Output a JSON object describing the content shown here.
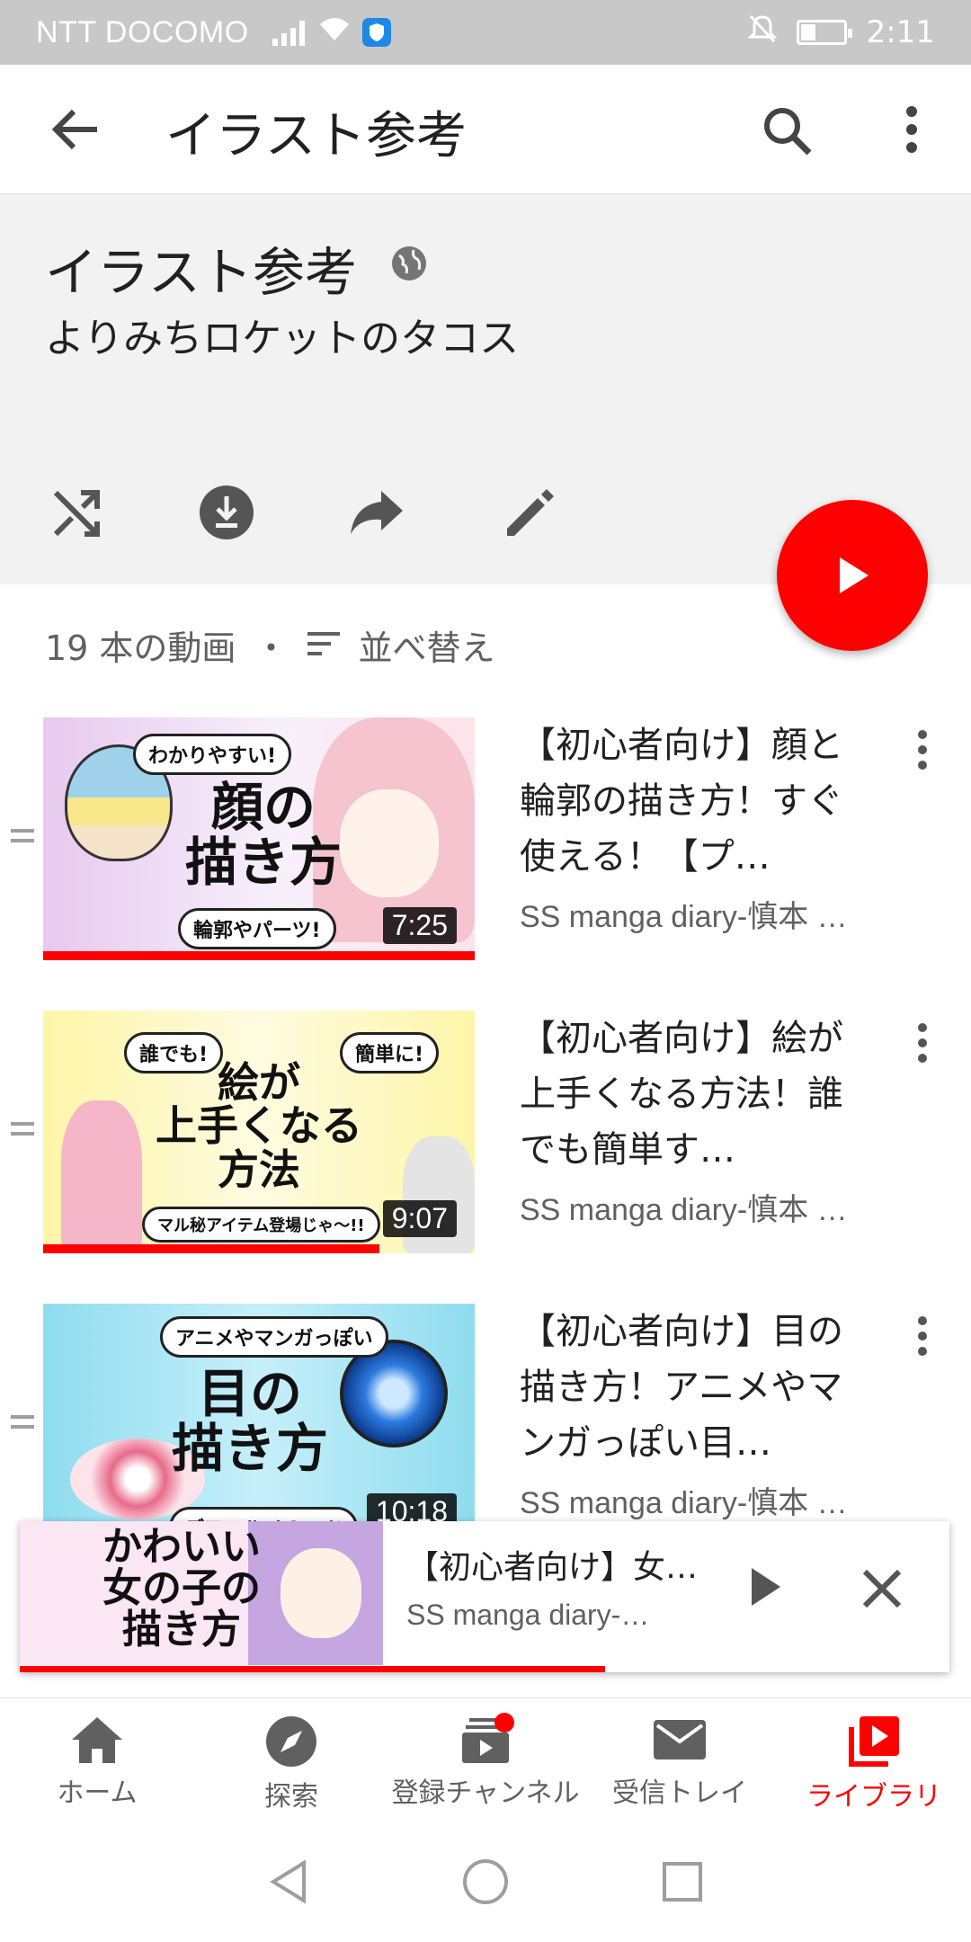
{
  "status_bar": {
    "carrier": "NTT DOCOMO",
    "time": "2:11",
    "icons": [
      "signal-icon",
      "wifi-icon",
      "vpn-shield-icon",
      "mute-icon",
      "battery-icon"
    ],
    "battery_level": 0.35
  },
  "app_bar": {
    "title": "イラスト参考",
    "icons": [
      "back-arrow-icon",
      "search-icon",
      "more-vert-icon"
    ]
  },
  "playlist": {
    "title": "イラスト参考",
    "owner": "よりみちロケットのタコス",
    "privacy_icon": "globe-icon",
    "actions": [
      "shuffle-icon",
      "download-icon",
      "share-icon",
      "edit-icon"
    ],
    "count": "19 本の動画",
    "separator": "・",
    "sort_label": "並べ替え"
  },
  "videos": [
    {
      "title": "【初心者向け】顔と輪郭の描き方！すぐ使える！【プ…",
      "channel": "SS manga diary-慎本 …",
      "duration": "7:25",
      "progress": 1.0,
      "thumb_main": "顔の\n描き方",
      "thumb_bubble": "わかりやすい!",
      "thumb_sub": "輪郭やパーツ!"
    },
    {
      "title": "【初心者向け】絵が上手くなる方法！誰でも簡単す…",
      "channel": "SS manga diary-慎本 …",
      "duration": "9:07",
      "progress": 0.78,
      "thumb_main": "絵が\n上手くなる\n方法",
      "thumb_bubble": "誰でも!",
      "thumb_bubble2": "簡単に!",
      "thumb_sub": "マル秘アイテム登場じゃ〜!!"
    },
    {
      "title": "【初心者向け】目の描き方！アニメやマンガっぽい目…",
      "channel": "SS manga diary-慎本 …",
      "duration": "10:18",
      "progress": 0.0,
      "thumb_main": "目の\n描き方",
      "thumb_bubble": "アニメやマンガっぽい",
      "thumb_sub": "デフォルメのコツ"
    }
  ],
  "mini_player": {
    "title": "【初心者向け】女…",
    "channel": "SS manga diary-…",
    "thumb_text": "かわいい\n女の子の\n描き方",
    "progress": 0.63
  },
  "bottom_nav": [
    {
      "label": "ホーム",
      "icon": "home-icon"
    },
    {
      "label": "探索",
      "icon": "explore-icon"
    },
    {
      "label": "登録チャンネル",
      "icon": "subscriptions-icon"
    },
    {
      "label": "受信トレイ",
      "icon": "inbox-icon"
    },
    {
      "label": "ライブラリ",
      "icon": "library-icon",
      "active": true
    }
  ],
  "colors": {
    "accent": "#ff0000",
    "header_bg": "#f2f2f2",
    "secondary_text": "#606060"
  }
}
